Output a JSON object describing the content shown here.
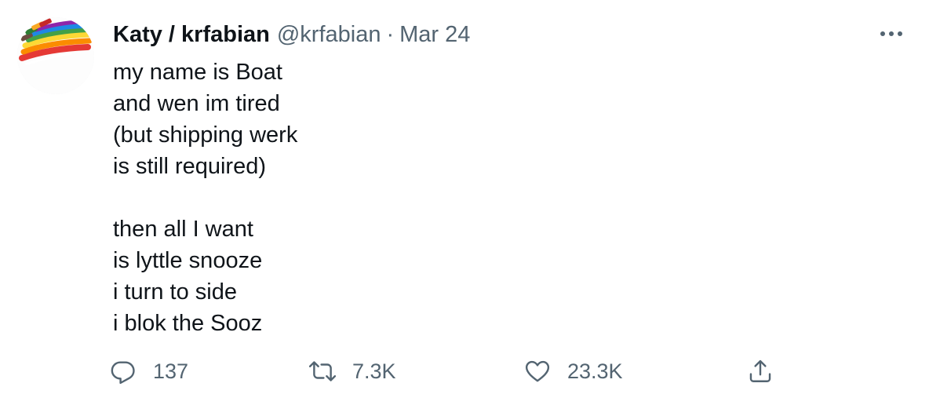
{
  "tweet": {
    "display_name": "Katy / krfabian",
    "handle": "@krfabian",
    "separator": "·",
    "date": "Mar 24",
    "lines": [
      "my name is Boat",
      "and wen im tired",
      "(but shipping werk",
      "is still required)",
      "",
      "then all I want",
      "is lyttle snooze",
      "i turn to side",
      "i blok the Sooz"
    ]
  },
  "actions": {
    "reply_count": "137",
    "retweet_count": "7.3K",
    "like_count": "23.3K"
  },
  "icons": {
    "more": "more-horizontal-icon",
    "reply": "reply-icon",
    "retweet": "retweet-icon",
    "like": "heart-icon",
    "share": "share-icon"
  },
  "colors": {
    "text": "#0f1419",
    "secondary": "#536471"
  }
}
